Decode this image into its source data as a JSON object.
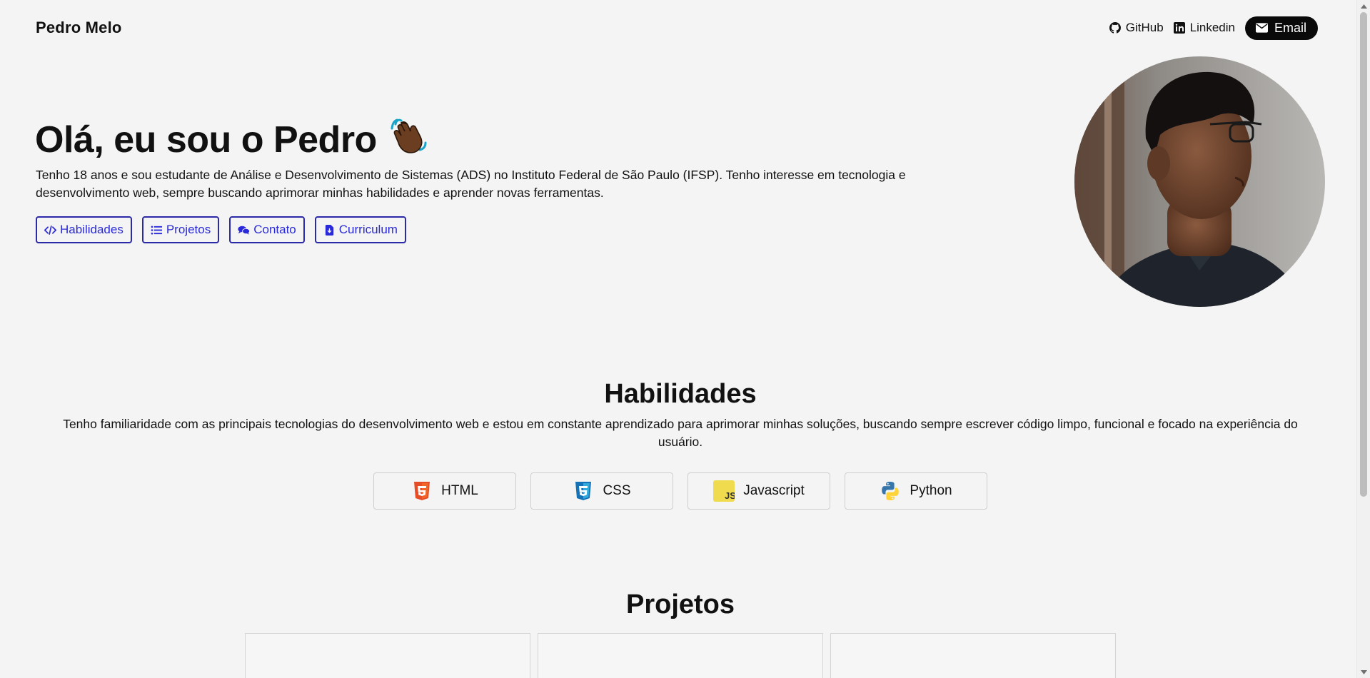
{
  "header": {
    "brand": "Pedro Melo",
    "nav": {
      "github": "GitHub",
      "linkedin": "Linkedin",
      "email": "Email"
    }
  },
  "hero": {
    "title": "Olá, eu sou o Pedro",
    "emoji": "👋🏾",
    "description": "Tenho 18 anos e sou estudante de Análise e Desenvolvimento de Sistemas (ADS) no Instituto Federal de São Paulo (IFSP). Tenho interesse em tecnologia e desenvolvimento web, sempre buscando aprimorar minhas habilidades e aprender novas ferramentas.",
    "buttons": [
      {
        "label": "Habilidades",
        "icon": "code-icon"
      },
      {
        "label": "Projetos",
        "icon": "list-icon"
      },
      {
        "label": "Contato",
        "icon": "comments-icon"
      },
      {
        "label": "Curriculum",
        "icon": "file-download-icon"
      }
    ]
  },
  "skills": {
    "title": "Habilidades",
    "description": "Tenho familiaridade com as principais tecnologias do desenvolvimento web e estou em constante aprendizado para aprimorar minhas soluções, buscando sempre escrever código limpo, funcional e focado na experiência do usuário.",
    "items": [
      {
        "label": "HTML",
        "icon": "html5-icon"
      },
      {
        "label": "CSS",
        "icon": "css3-icon"
      },
      {
        "label": "Javascript",
        "icon": "javascript-icon"
      },
      {
        "label": "Python",
        "icon": "python-icon"
      }
    ]
  },
  "projects": {
    "title": "Projetos"
  },
  "colors": {
    "accent": "#2a2ad8",
    "background": "#f4f4f4",
    "email_button": "#0a0a0a"
  }
}
